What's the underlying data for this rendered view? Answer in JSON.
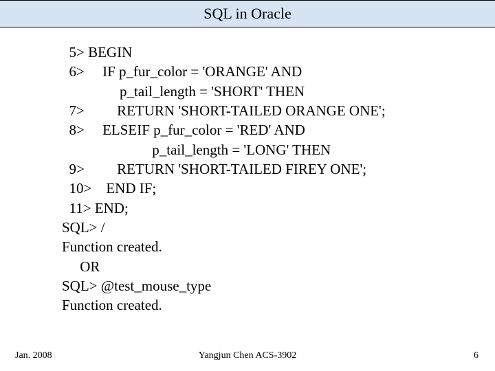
{
  "title": "SQL in Oracle",
  "code_block": "  5> BEGIN\n  6>     IF p_fur_color = 'ORANGE' AND\n                p_tail_length = 'SHORT' THEN\n  7>         RETURN 'SHORT-TAILED ORANGE ONE';\n  8>     ELSEIF p_fur_color = 'RED' AND\n                         p_tail_length = 'LONG' THEN\n  9>         RETURN 'SHORT-TAILED FIREY ONE';\n  10>    END IF;\n  11> END;\nSQL> /\nFunction created.\n     OR\nSQL> @test_mouse_type\nFunction created.",
  "footer": {
    "left": "Jan. 2008",
    "center": "Yangjun Chen        ACS-3902",
    "right": "6"
  }
}
